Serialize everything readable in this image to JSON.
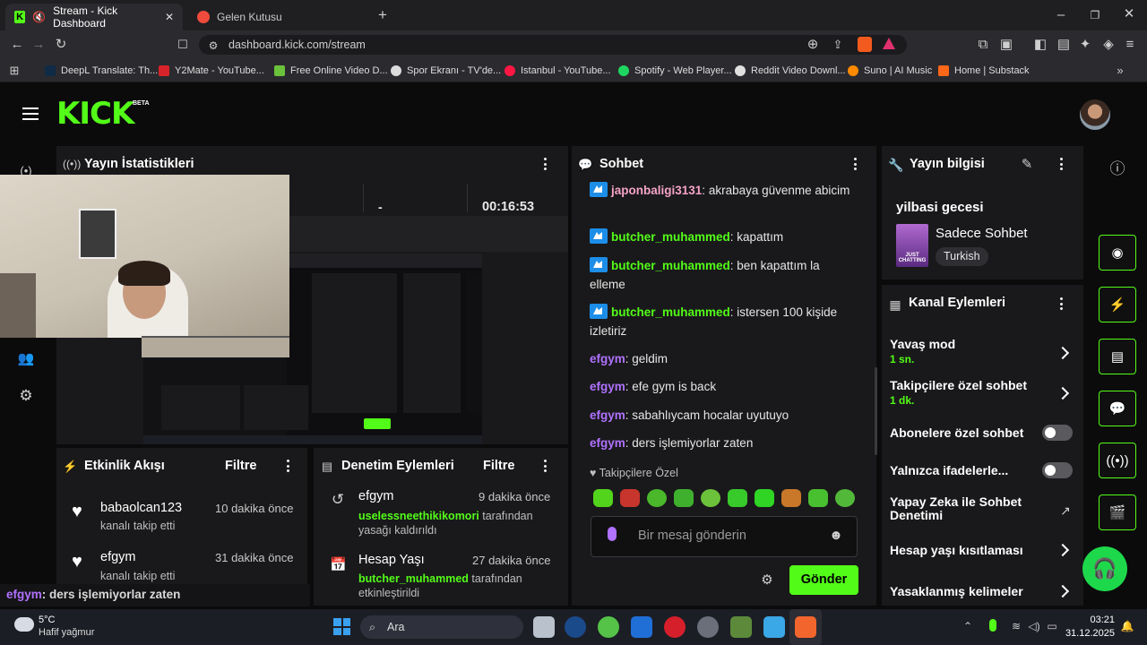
{
  "browser": {
    "tabs": [
      {
        "title": "Stream - Kick Dashboard",
        "active": true
      },
      {
        "title": "Gelen Kutusu",
        "active": false
      }
    ],
    "url": "dashboard.kick.com/stream",
    "bookmarks": [
      "DeepL Translate: Th...",
      "Y2Mate - YouTube...",
      "Free Online Video D...",
      "Spor Ekranı - TV'de...",
      "Istanbul - YouTube...",
      "Spotify - Web Player...",
      "Reddit Video Downl...",
      "Suno | AI Music",
      "Home | Substack"
    ]
  },
  "header": {
    "logo": "KICK",
    "beta": "BETA"
  },
  "stats": {
    "title": "Yayın İstatistikleri",
    "value_mid": "-",
    "duration": "00:16:53"
  },
  "activity": {
    "title": "Etkinlik Akışı",
    "filter": "Filtre",
    "items": [
      {
        "user": "babaolcan123",
        "time": "10 dakika önce",
        "text": "kanalı takip etti"
      },
      {
        "user": "efgym",
        "time": "31 dakika önce",
        "text": "kanalı takip etti"
      }
    ]
  },
  "moderation": {
    "title": "Denetim Eylemleri",
    "filter": "Filtre",
    "items": [
      {
        "user": "efgym",
        "time": "9 dakika önce",
        "actor": "uselessneethikikomori",
        "text1": " tarafından",
        "text2": "yasağı kaldırıldı"
      },
      {
        "user": "Hesap Yaşı",
        "time": "27 dakika önce",
        "actor": "butcher_muhammed",
        "text1": " tarafından",
        "text2": "etkinleştirildi"
      }
    ]
  },
  "chat": {
    "title": "Sohbet",
    "messages": [
      {
        "user": "japonbaligi3131",
        "text": " akrabaya güvenme abicim",
        "color": "#f5a3c7",
        "badge": true
      },
      {
        "user": "butcher_muhammed",
        "text": " kapattım",
        "color": "#53fc18",
        "badge": true
      },
      {
        "user": "butcher_muhammed",
        "text": " ben kapattım la elleme",
        "color": "#53fc18",
        "badge": true
      },
      {
        "user": "butcher_muhammed",
        "text": " istersen 100 kişide izletiriz",
        "color": "#53fc18",
        "badge": true
      },
      {
        "user": "efgym",
        "text": " geldim",
        "color": "#b072ff",
        "badge": false
      },
      {
        "user": "efgym",
        "text": " efe gym is back",
        "color": "#b072ff",
        "badge": false
      },
      {
        "user": "efgym",
        "text": " sabahlıycam hocalar uyutuyo",
        "color": "#b072ff",
        "badge": false
      },
      {
        "user": "efgym",
        "text": " ders işlemiyorlar zaten",
        "color": "#b072ff",
        "badge": false
      }
    ],
    "followers_only": "Takipçilere Özel",
    "placeholder": "Bir mesaj gönderin",
    "send": "Gönder"
  },
  "overlay_chat": {
    "user": "efgym",
    "text": ": ders işlemiyorlar zaten"
  },
  "stream_info": {
    "title": "Yayın bilgisi",
    "stream_title": "yilbasi gecesi",
    "category": "Sadece Sohbet",
    "category_thumb_text": "JUST CHATTING",
    "language": "Turkish"
  },
  "channel_actions": {
    "title": "Kanal Eylemleri",
    "items": [
      {
        "label": "Yavaş mod",
        "sub": "1 sn.",
        "control": "chevron"
      },
      {
        "label": "Takipçilere özel sohbet",
        "sub": "1 dk.",
        "control": "chevron"
      },
      {
        "label": "Abonelere özel sohbet",
        "sub": "",
        "control": "toggle"
      },
      {
        "label": "Yalnızca ifadelerle...",
        "sub": "",
        "control": "toggle"
      },
      {
        "label": "Yapay Zeka ile Sohbet Denetimi",
        "sub": "",
        "control": "external"
      },
      {
        "label": "Hesap yaşı kısıtlaması",
        "sub": "",
        "control": "chevron"
      },
      {
        "label": "Yasaklanmış kelimeler",
        "sub": "",
        "control": "chevron"
      }
    ]
  },
  "taskbar": {
    "weather_temp": "5°C",
    "weather_desc": "Hafif yağmur",
    "search": "Ara",
    "time": "03:21",
    "date": "31.12.2025"
  },
  "colors": {
    "accent": "#53fc18",
    "panel": "#19191b",
    "background": "#0b0b0c"
  }
}
